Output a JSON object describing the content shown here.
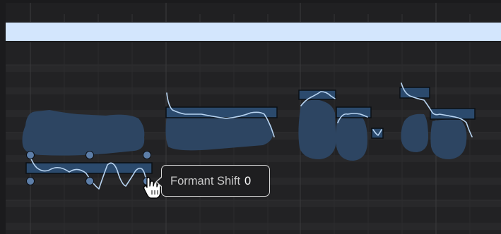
{
  "tooltip": {
    "label": "Formant Shift",
    "value": "0"
  },
  "cursor": {
    "icon": "hand-pointer-icon"
  },
  "colors": {
    "background": "#1b1b1d",
    "ruler": "#202022",
    "region_header": "#d3e6fd",
    "waveform": "#2d4562",
    "note_fill": "#2b4a6d",
    "pitch_curve": "#b8d4f1",
    "handle": "#5d7ea8"
  },
  "notes": [
    {
      "name": "note-1",
      "selected": true,
      "handles": true
    },
    {
      "name": "note-2",
      "selected": false
    },
    {
      "name": "note-3",
      "selected": false
    },
    {
      "name": "note-4",
      "selected": false
    },
    {
      "name": "note-5",
      "selected": false
    },
    {
      "name": "note-6",
      "selected": false
    },
    {
      "name": "note-7",
      "selected": false
    }
  ]
}
